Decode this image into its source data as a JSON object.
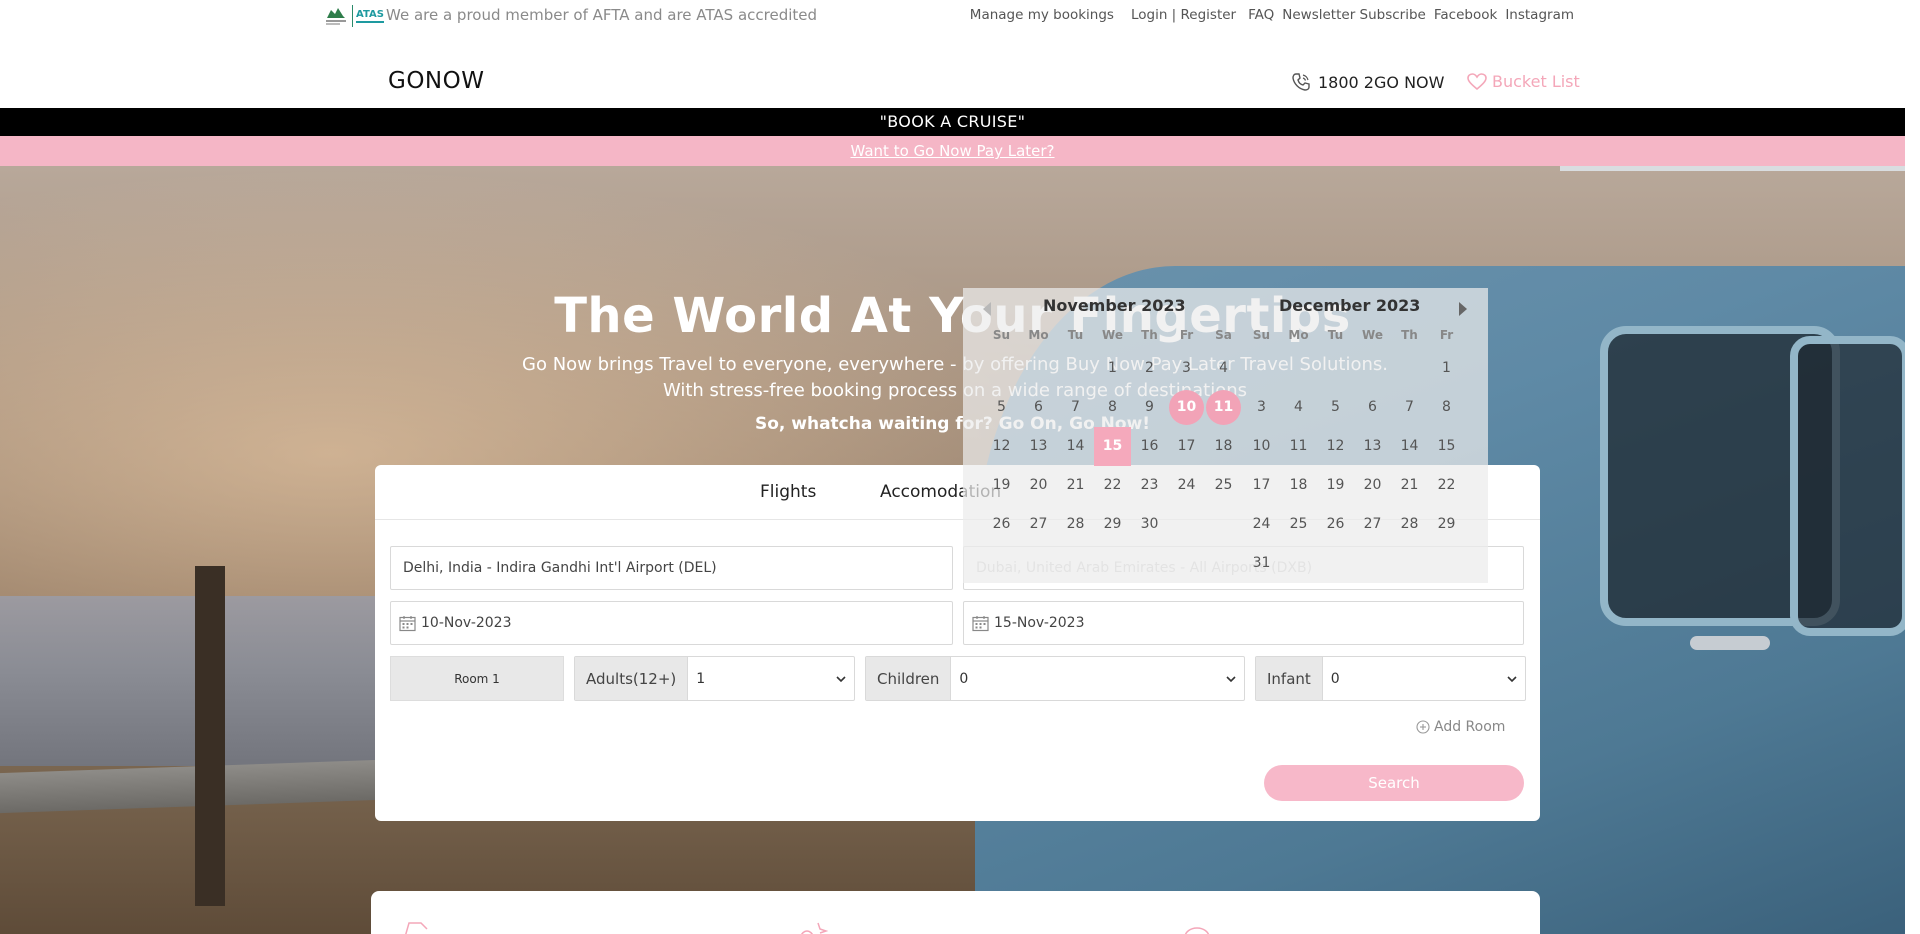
{
  "topbar": {
    "accreditation": "We are a proud member of AFTA and are ATAS accredited",
    "atas_logo": "ATAS",
    "links": {
      "manage": "Manage my bookings",
      "login": "Login | Register",
      "faq": "FAQ",
      "newsletter": "Newsletter Subscribe",
      "facebook": "Facebook",
      "instagram": "Instagram"
    }
  },
  "header": {
    "logo": "GONOW",
    "phone": "1800 2GO NOW",
    "bucket_list": "Bucket List"
  },
  "banners": {
    "cruise": "\"BOOK A CRUISE\"",
    "pay_later": "Want to Go Now Pay Later?"
  },
  "hero": {
    "title": "The World At Your Fingertips",
    "subtitle": "Go Now brings Travel to everyone, everywhere - by offering Buy Now Pay Later Travel Solutions. With stress-free booking process on a wide range of destinations",
    "cta": "So, whatcha waiting for? Go On, Go Now!"
  },
  "booking": {
    "tabs": {
      "flights": "Flights",
      "accommodation": "Accomodation"
    },
    "from_value": "Delhi, India - Indira Gandhi Int'l Airport (DEL)",
    "to_value": "Dubai, United Arab Emirates - All Airports (DXB)",
    "depart_date": "10-Nov-2023",
    "return_date": "15-Nov-2023",
    "room_label": "Room 1",
    "adults_label": "Adults(12+)",
    "adults_value": "1",
    "children_label": "Children",
    "children_value": "0",
    "infant_label": "Infant",
    "infant_value": "0",
    "add_room": "Add Room",
    "search": "Search"
  },
  "datepicker": {
    "dows": [
      "Su",
      "Mo",
      "Tu",
      "We",
      "Th",
      "Fr",
      "Sa"
    ],
    "dows_m2": [
      "Su",
      "Mo",
      "Tu",
      "We",
      "Th",
      "Fr"
    ],
    "month1": {
      "title": "November 2023",
      "weeks": [
        [
          "",
          "",
          "",
          "1",
          "2",
          "3",
          "4"
        ],
        [
          "5",
          "6",
          "7",
          "8",
          "9",
          "10",
          "11"
        ],
        [
          "12",
          "13",
          "14",
          "15",
          "16",
          "17",
          "18"
        ],
        [
          "19",
          "20",
          "21",
          "22",
          "23",
          "24",
          "25"
        ],
        [
          "26",
          "27",
          "28",
          "29",
          "30",
          "",
          ""
        ]
      ],
      "selected_circle": [
        "10",
        "11"
      ],
      "selected_square": [
        "15"
      ]
    },
    "month2": {
      "title": "December 2023",
      "weeks": [
        [
          "",
          "",
          "",
          "",
          "",
          "1"
        ],
        [
          "3",
          "4",
          "5",
          "6",
          "7",
          "8"
        ],
        [
          "10",
          "11",
          "12",
          "13",
          "14",
          "15"
        ],
        [
          "17",
          "18",
          "19",
          "20",
          "21",
          "22"
        ],
        [
          "24",
          "25",
          "26",
          "27",
          "28",
          "29"
        ],
        [
          "31",
          "",
          "",
          "",
          "",
          ""
        ]
      ]
    }
  },
  "colors": {
    "accent_pink": "#f5b6c6",
    "selected_pink": "#f2a3b7"
  }
}
